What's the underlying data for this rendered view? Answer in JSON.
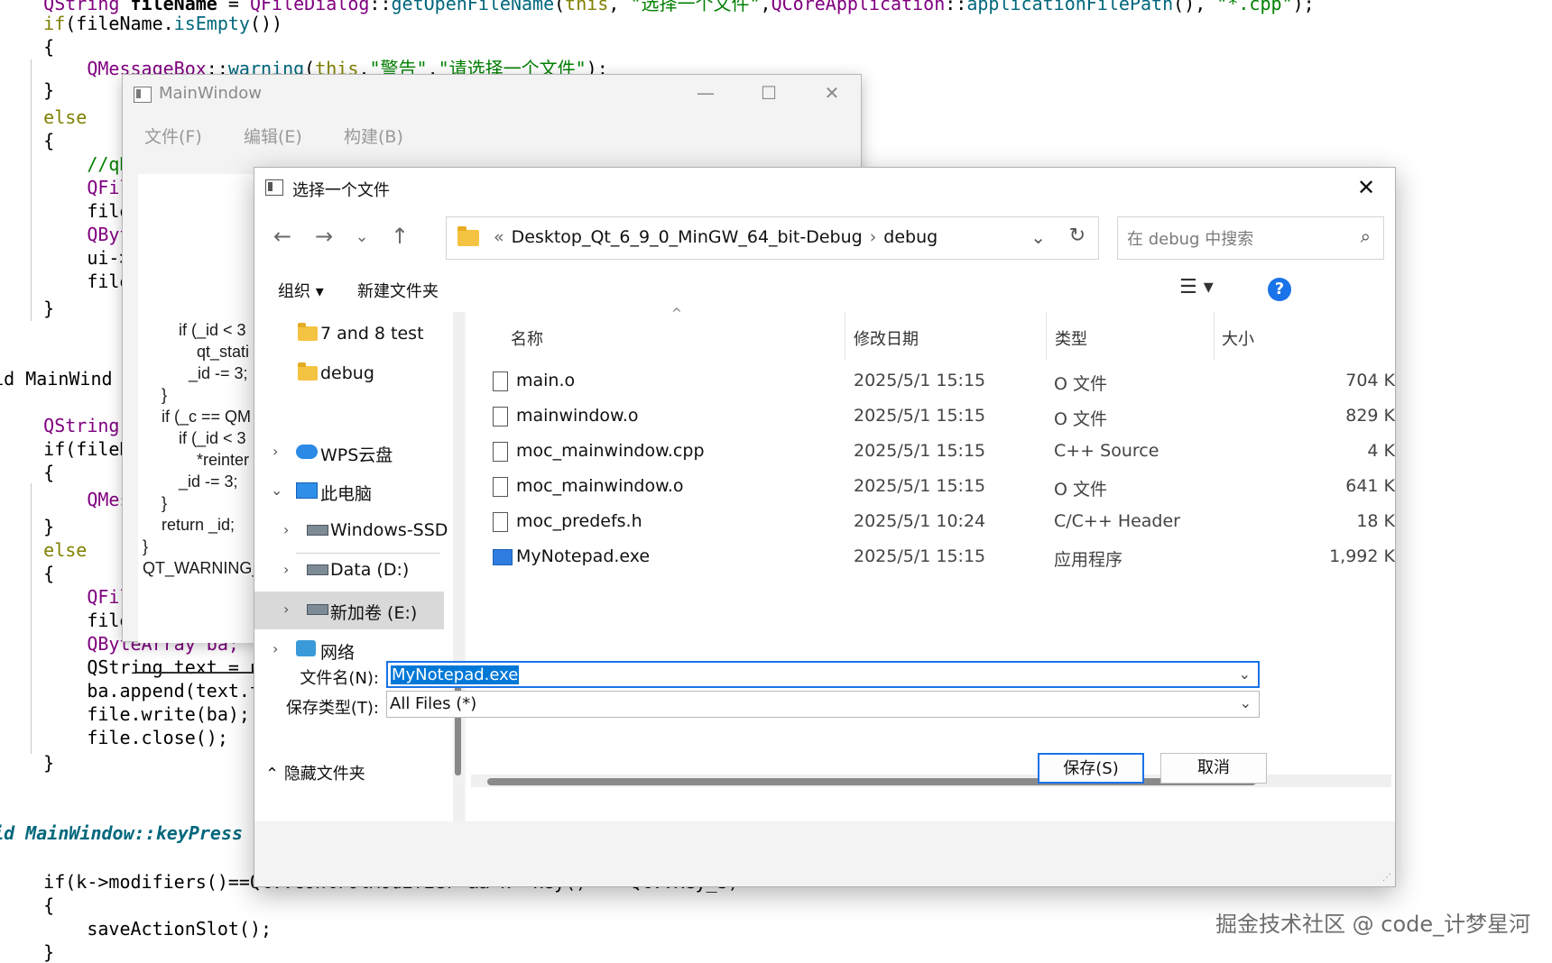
{
  "editor": {
    "lines": [
      {
        "t": "    QString fileName = QFileDialog::getOpenFileName(this,\"选择一个文件\",QCoreApplication::applicationFilePath(),\"*.cpp\");"
      },
      {
        "t": "    if(fileName.isEmpty())"
      },
      {
        "t": "    {"
      },
      {
        "t": "        QMessageBox::warning(this,\"警告\",\"请选择一个文件\");"
      },
      {
        "t": "    }"
      },
      {
        "t": "    else"
      },
      {
        "t": "    {"
      },
      {
        "t": "        //qDe"
      },
      {
        "t": "        QFile"
      },
      {
        "t": "        file."
      },
      {
        "t": "        QByte"
      },
      {
        "t": "        ui->t"
      },
      {
        "t": "        file."
      },
      {
        "t": "    }"
      },
      {
        "t": "void MainWind"
      },
      {
        "t": "    QString f"
      },
      {
        "t": "    if(fileNa"
      },
      {
        "t": "    {"
      },
      {
        "t": "        QMess"
      },
      {
        "t": "    }"
      },
      {
        "t": "    else"
      },
      {
        "t": "    {"
      },
      {
        "t": "        QFile"
      },
      {
        "t": "        file."
      },
      {
        "t": "        QByteArray ba;"
      },
      {
        "t": "        QString text = ui"
      },
      {
        "t": "        ba.append(text.to"
      },
      {
        "t": "        file.write(ba);"
      },
      {
        "t": "        file.close();"
      },
      {
        "t": "    }"
      },
      {
        "t": "void MainWindow::keyPress"
      },
      {
        "t": "    if(k->modifiers()==Qt::ControlModifier && k->key() == Qt::Key_S)"
      },
      {
        "t": "    {"
      },
      {
        "t": "        saveActionSlot();"
      },
      {
        "t": "    }"
      }
    ],
    "watermark": "掘金技术社区 @ code_计梦星河"
  },
  "mainwindow": {
    "title": "MainWindow",
    "menu": [
      "文件(F)",
      "编辑(E)",
      "构建(B)"
    ],
    "code": [
      "if (_id < 3",
      "    qt_stati",
      "_id -= 3;",
      "}",
      "if (_c == QM",
      "    if (_id < 3",
      "        *reinter",
      "    _id -= 3;",
      "}",
      "return _id;",
      "}",
      "QT_WARNING_"
    ]
  },
  "dialog": {
    "title": "选择一个文件",
    "close_glyph": "✕",
    "breadcrumb": [
      "«",
      "Desktop_Qt_6_9_0_MinGW_64_bit-Debug",
      "›",
      "debug"
    ],
    "search_placeholder": "在 debug 中搜索",
    "organize_label": "组织 ▾",
    "new_folder_label": "新建文件夹",
    "help_label": "?",
    "nav": [
      {
        "label": "7 and 8 test",
        "icon": "folder-icon"
      },
      {
        "label": "debug",
        "icon": "folder-icon"
      },
      {
        "label": "WPS云盘",
        "icon": "cloud-icon"
      },
      {
        "label": "此电脑",
        "icon": "computer-icon"
      },
      {
        "label": "Windows-SSD",
        "icon": "drive-icon"
      },
      {
        "label": "Data (D:)",
        "icon": "drive-icon"
      },
      {
        "label": "新加卷 (E:)",
        "icon": "drive-icon"
      },
      {
        "label": "网络",
        "icon": "network-icon"
      }
    ],
    "columns": {
      "name": "名称",
      "date": "修改日期",
      "type": "类型",
      "size": "大小"
    },
    "files": [
      {
        "name": "main.o",
        "date": "2025/5/1 15:15",
        "type": "O 文件",
        "size": "704 K"
      },
      {
        "name": "mainwindow.o",
        "date": "2025/5/1 15:15",
        "type": "O 文件",
        "size": "829 K"
      },
      {
        "name": "moc_mainwindow.cpp",
        "date": "2025/5/1 15:15",
        "type": "C++ Source",
        "size": "4 K"
      },
      {
        "name": "moc_mainwindow.o",
        "date": "2025/5/1 15:15",
        "type": "O 文件",
        "size": "641 K"
      },
      {
        "name": "moc_predefs.h",
        "date": "2025/5/1 10:24",
        "type": "C/C++ Header",
        "size": "18 K"
      },
      {
        "name": "MyNotepad.exe",
        "date": "2025/5/1 15:15",
        "type": "应用程序",
        "size": "1,992 K"
      }
    ],
    "filename_label": "文件名(N):",
    "filename_value": "MyNotepad.exe",
    "filetype_label": "保存类型(T):",
    "filetype_value": "All Files (*)",
    "hide_folders_label": "隐藏文件夹",
    "save_label": "保存(S)",
    "cancel_label": "取消"
  }
}
